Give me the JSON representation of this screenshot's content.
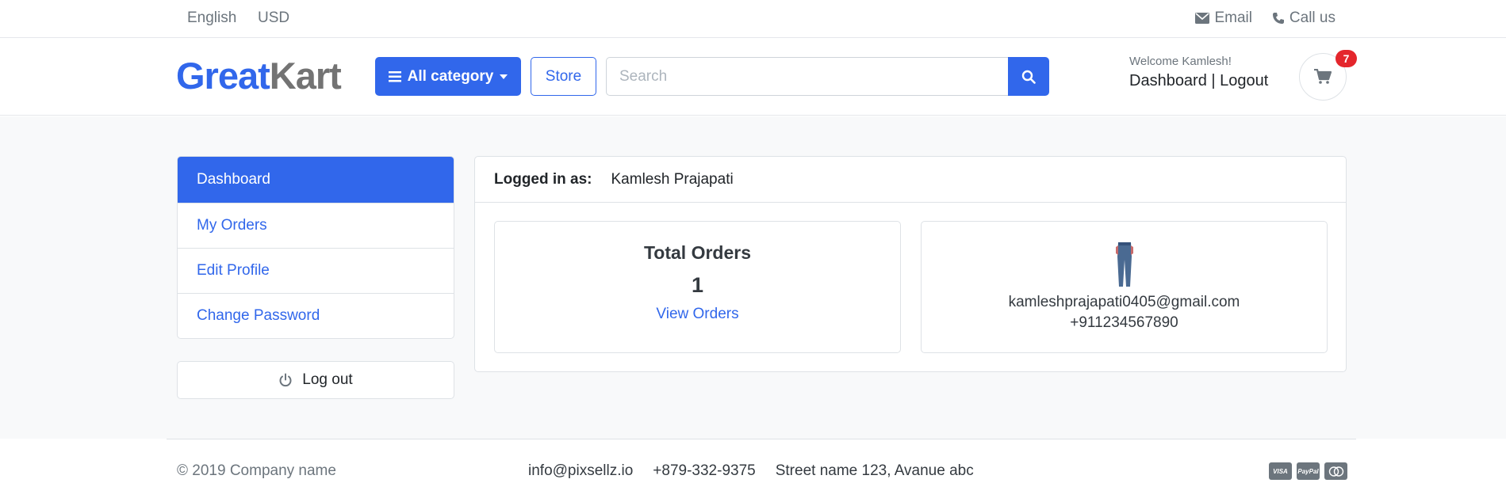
{
  "topbar": {
    "language": "English",
    "currency": "USD",
    "email": "Email",
    "call": "Call us"
  },
  "header": {
    "logo_part1": "Great",
    "logo_part2": "Kart",
    "category_label": "All category",
    "store_label": "Store",
    "search_placeholder": "Search",
    "welcome": "Welcome Kamlesh!",
    "dashboard_link": "Dashboard",
    "separator": "|",
    "logout_link": "Logout",
    "cart_count": "7"
  },
  "sidebar": {
    "items": [
      {
        "label": "Dashboard"
      },
      {
        "label": "My Orders"
      },
      {
        "label": "Edit Profile"
      },
      {
        "label": "Change Password"
      }
    ],
    "logout_label": "Log out"
  },
  "dashboard": {
    "logged_in_label": "Logged in as:",
    "user_name": "Kamlesh Prajapati",
    "total_orders_label": "Total Orders",
    "total_orders_value": "1",
    "view_orders_label": "View Orders",
    "email": "kamleshprajapati0405@gmail.com",
    "phone": "+911234567890"
  },
  "footer": {
    "copyright": "© 2019 Company name",
    "email": "info@pixsellz.io",
    "phone": "+879-332-9375",
    "address": "Street name 123, Avanue abc",
    "payments": [
      "VISA",
      "PayPal",
      "MC"
    ]
  },
  "colors": {
    "primary": "#3167eb",
    "badge": "#e4262c",
    "muted": "#6c757d"
  }
}
